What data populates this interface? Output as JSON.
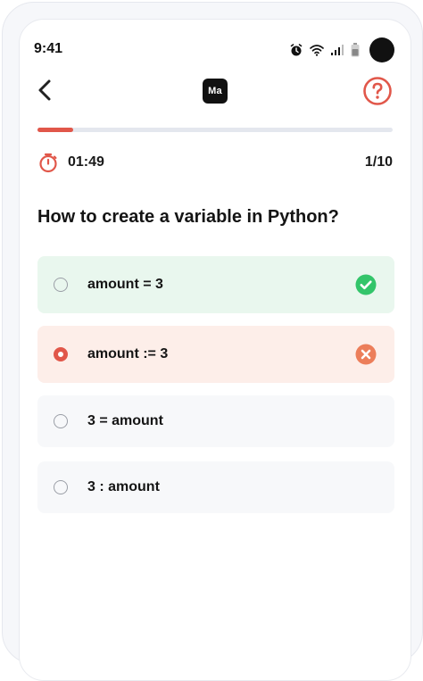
{
  "status_bar": {
    "time": "9:41",
    "icons": [
      "alarm-icon",
      "wifi-icon",
      "signal-icon",
      "battery-icon"
    ]
  },
  "header": {
    "logo_text": "Ma",
    "icons": [
      "back-chevron-icon",
      "help-question-icon"
    ]
  },
  "progress": {
    "fraction": 0.1,
    "accent": "#e1574a",
    "track": "#e4e7ee"
  },
  "timer": {
    "time": "01:49",
    "icon": "stopwatch-icon"
  },
  "counter": "1/10",
  "question": "How to create a variable in Python?",
  "options": [
    {
      "label": "amount = 3",
      "state": "correct",
      "icon": "check-circle-icon",
      "color": "#33c56a"
    },
    {
      "label": "amount := 3",
      "state": "wrong",
      "icon": "close-circle-icon",
      "color": "#ec7e5a"
    },
    {
      "label": "3 = amount",
      "state": "none"
    },
    {
      "label": "3 : amount",
      "state": "none"
    }
  ]
}
